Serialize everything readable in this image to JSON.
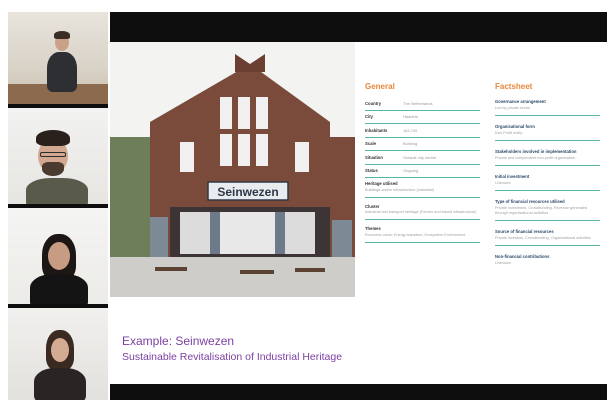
{
  "meeting": {
    "participant_count": 4
  },
  "slide": {
    "sign_text": "Seinwezen",
    "caption_title": "Example: Seinwezen",
    "caption_subtitle": "Sustainable Revitalisation of Industrial Heritage",
    "general": {
      "title": "General",
      "rows": [
        {
          "key": "Country",
          "value": "The Netherlands"
        },
        {
          "key": "City",
          "value": "Haarlem"
        },
        {
          "key": "Inhabitants",
          "value": "162,745"
        },
        {
          "key": "Scale",
          "value": "Building"
        },
        {
          "key": "Situation",
          "value": "Outside city centre"
        },
        {
          "key": "Status",
          "value": "Ongoing"
        }
      ],
      "blocks": [
        {
          "key": "Heritage utilised",
          "value": "Buildings and/or infrastructure (industrial)"
        },
        {
          "key": "Cluster",
          "value": "Industrial and transport heritage (Former and transit infrastructure)"
        },
        {
          "key": "Themes",
          "value": "Economic value; Energy transition; Ecosystem Environment"
        }
      ]
    },
    "factsheet": {
      "title": "Factsheet",
      "items": [
        {
          "key": "Governance arrangement",
          "value": "Led by private sector"
        },
        {
          "key": "Organisational form",
          "value": "Non-Profit entity"
        },
        {
          "key": "Stakeholders involved in implementation",
          "value": "Private and independent non-profit organisation"
        },
        {
          "key": "Initial investment",
          "value": "Unknown"
        },
        {
          "key": "Type of financial resources utilised",
          "value": "Private investment, Crowdfunding, Revenue generated through organisational activities"
        },
        {
          "key": "Source of financial resources",
          "value": "Private investors, Crowdfunding, Organisational activities"
        },
        {
          "key": "Non-financial contributions",
          "value": "Unknown"
        }
      ]
    }
  },
  "colors": {
    "accent_orange": "#e6883c",
    "accent_teal": "#55b7a6",
    "caption_purple": "#7b3fa1",
    "brick": "#7a4a3a"
  }
}
